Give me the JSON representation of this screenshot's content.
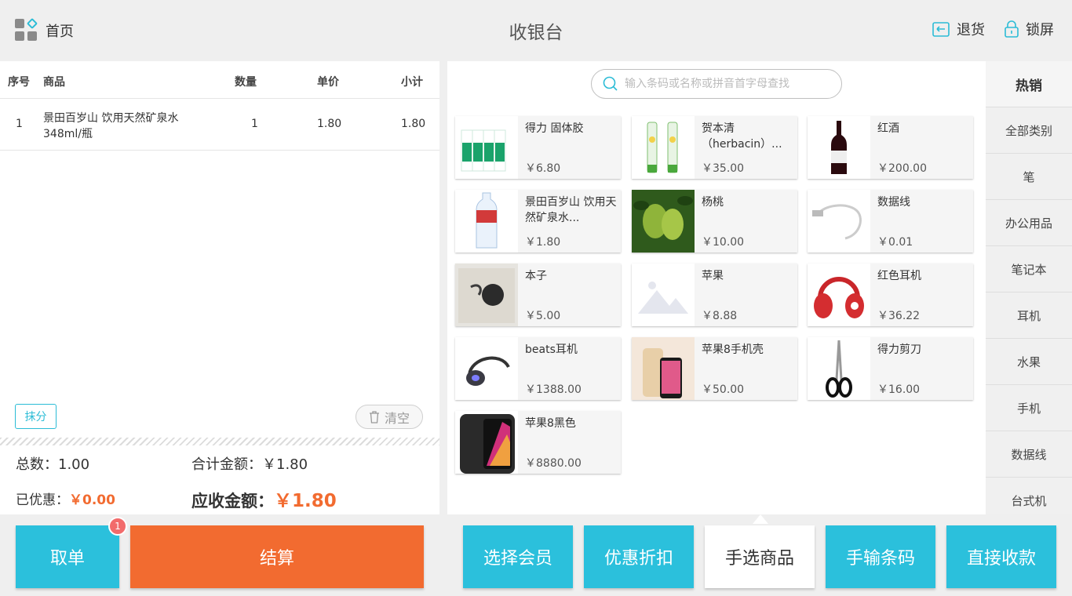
{
  "header": {
    "home_label": "首页",
    "title": "收银台",
    "return_label": "退货",
    "lock_label": "锁屏"
  },
  "order_table": {
    "columns": [
      "序号",
      "商品",
      "数量",
      "单价",
      "小计"
    ],
    "rows": [
      {
        "index": "1",
        "name_line1": "景田百岁山 饮用天然矿泉水",
        "name_line2": "348ml/瓶",
        "qty": "1",
        "price": "1.80",
        "subtotal": "1.80"
      }
    ]
  },
  "actions": {
    "round_label": "抹分",
    "clear_label": "清空"
  },
  "summary": {
    "count_label": "总数：",
    "count_value": "1.00",
    "total_label": "合计金额：",
    "total_value": "￥1.80",
    "discount_label": "已优惠：",
    "discount_value": "￥0.00",
    "due_label": "应收金额：",
    "due_value": "￥1.80"
  },
  "search": {
    "placeholder": "输入条码或名称或拼音首字母查找"
  },
  "products": [
    {
      "name": "得力 固体胶",
      "price": "￥6.80"
    },
    {
      "name": "贺本清（herbacin）...",
      "price": "￥35.00"
    },
    {
      "name": "红酒",
      "price": "￥200.00"
    },
    {
      "name": "景田百岁山 饮用天然矿泉水...",
      "price": "￥1.80"
    },
    {
      "name": "杨桃",
      "price": "￥10.00"
    },
    {
      "name": "数据线",
      "price": "￥0.01"
    },
    {
      "name": "本子",
      "price": "￥5.00"
    },
    {
      "name": "苹果",
      "price": "￥8.88"
    },
    {
      "name": "红色耳机",
      "price": "￥36.22"
    },
    {
      "name": "beats耳机",
      "price": "￥1388.00"
    },
    {
      "name": "苹果8手机壳",
      "price": "￥50.00"
    },
    {
      "name": "得力剪刀",
      "price": "￥16.00"
    },
    {
      "name": "苹果8黑色",
      "price": "￥8880.00"
    }
  ],
  "categories": [
    "热销",
    "全部类别",
    "笔",
    "办公用品",
    "笔记本",
    "耳机",
    "水果",
    "手机",
    "数据线",
    "台式机"
  ],
  "bottom": {
    "cancel_label": "取单",
    "cancel_badge": "1",
    "checkout_label": "结算",
    "member_label": "选择会员",
    "discount_label": "优惠折扣",
    "pick_label": "手选商品",
    "barcode_label": "手输条码",
    "direct_label": "直接收款"
  },
  "colors": {
    "accent": "#2bc0dc",
    "checkout": "#f26b30",
    "price_highlight": "#f26b30"
  }
}
